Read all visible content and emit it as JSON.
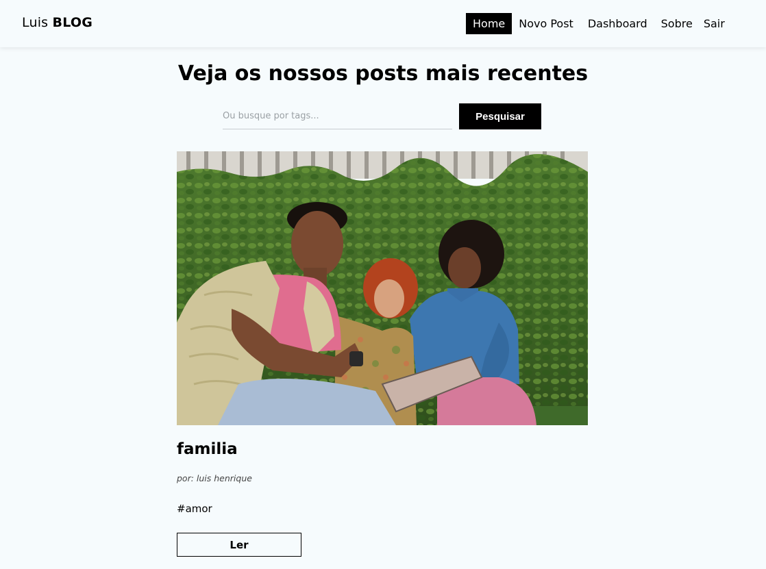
{
  "navbar": {
    "brand_prefix": "Luis",
    "brand_strong": "BLOG",
    "links": [
      {
        "label": "Home"
      },
      {
        "label": "Novo Post"
      },
      {
        "label": "Dashboard"
      },
      {
        "label": "Sobre"
      },
      {
        "label": "Sair"
      }
    ]
  },
  "main": {
    "title": "Veja os nossos posts mais recentes",
    "search": {
      "placeholder": "Ou busque por tags...",
      "value": "",
      "button_label": "Pesquisar"
    },
    "posts": [
      {
        "title": "familia",
        "author": "por: luis henrique",
        "tags": [
          "#amor"
        ],
        "read_label": "Ler"
      }
    ]
  },
  "colors": {
    "background": "#f6fbfd",
    "accent": "#000000",
    "accent_text": "#ffffff"
  }
}
